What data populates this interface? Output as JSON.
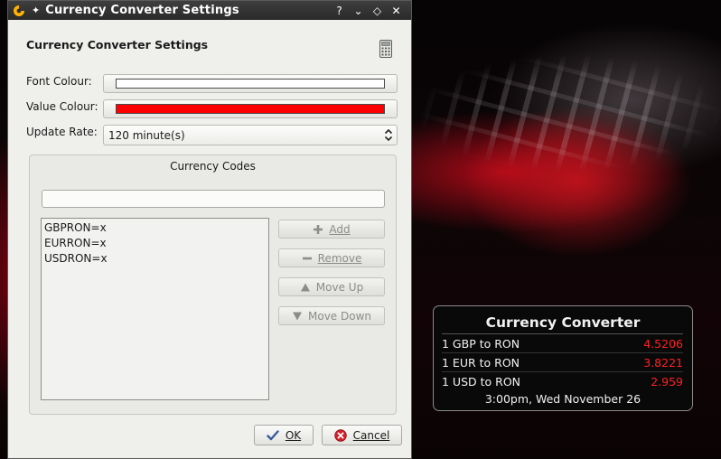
{
  "window": {
    "title": "Currency Converter Settings",
    "buttons": [
      "?",
      "⌄",
      "◇",
      "✕"
    ]
  },
  "dialog": {
    "header_title": "Currency Converter Settings",
    "font_colour_label": "Font Colour:",
    "value_colour_label": "Value Colour:",
    "update_rate_label": "Update Rate:",
    "update_rate_value": "120 minute(s)",
    "font_colour": "#ffffff",
    "value_colour": "#ff0000"
  },
  "currency_codes": {
    "title": "Currency Codes",
    "input_value": "",
    "items": [
      "GBPRON=x",
      "EURRON=x",
      "USDRON=x"
    ],
    "add_label": "Add",
    "remove_label": "Remove",
    "move_up_label": "Move Up",
    "move_down_label": "Move Down"
  },
  "footer": {
    "ok_label": "OK",
    "cancel_label": "Cancel"
  },
  "widget": {
    "title": "Currency Converter",
    "rows": [
      {
        "label": "1 GBP to RON",
        "value": "4.5206"
      },
      {
        "label": "1 EUR to RON",
        "value": "3.8221"
      },
      {
        "label": "1 USD to RON",
        "value": "2.959"
      }
    ],
    "datetime": "3:00pm, Wed November 26"
  },
  "colors": {
    "value_text": "#ff2020",
    "titlebar": "#333333"
  }
}
